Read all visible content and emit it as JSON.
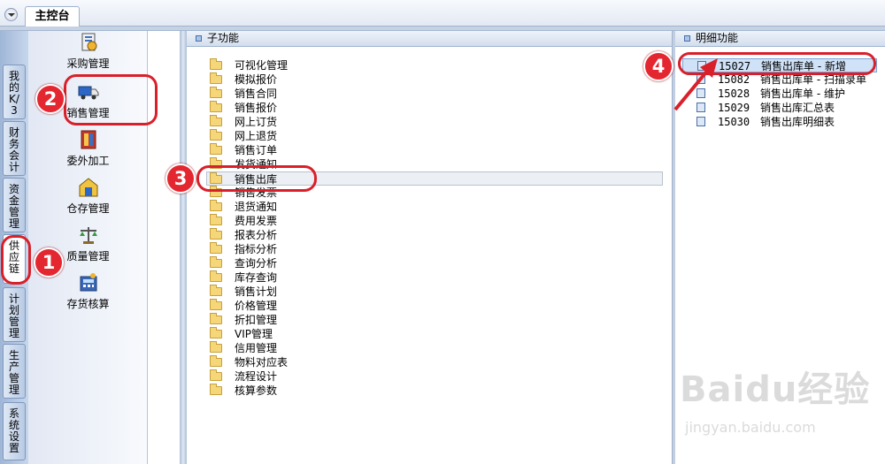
{
  "top_tab": {
    "label": "主控台"
  },
  "vertical_tabs": [
    {
      "label": "我的K/3",
      "active": false
    },
    {
      "label": "财务会计",
      "active": false
    },
    {
      "label": "资金管理",
      "active": false
    },
    {
      "label": "供应链",
      "active": true
    },
    {
      "label": "计划管理",
      "active": false
    },
    {
      "label": "生产管理",
      "active": false
    },
    {
      "label": "系统设置",
      "active": false
    }
  ],
  "modules": [
    {
      "label": "采购管理",
      "icon": "purchase-icon"
    },
    {
      "label": "销售管理",
      "icon": "sales-truck-icon",
      "selected": true
    },
    {
      "label": "委外加工",
      "icon": "outsource-icon"
    },
    {
      "label": "仓存管理",
      "icon": "warehouse-icon"
    },
    {
      "label": "质量管理",
      "icon": "quality-scale-icon"
    },
    {
      "label": "存货核算",
      "icon": "inventory-calc-icon"
    }
  ],
  "sub_panel": {
    "title": "子功能",
    "items": [
      "可视化管理",
      "模拟报价",
      "销售合同",
      "销售报价",
      "网上订货",
      "网上退货",
      "销售订单",
      "发货通知",
      "销售出库",
      "销售发票",
      "退货通知",
      "费用发票",
      "报表分析",
      "指标分析",
      "查询分析",
      "库存查询",
      "销售计划",
      "价格管理",
      "折扣管理",
      "VIP管理",
      "信用管理",
      "物料对应表",
      "流程设计",
      "核算参数"
    ],
    "selected_index": 8
  },
  "detail_panel": {
    "title": "明细功能",
    "items": [
      {
        "code": "15027",
        "label": "销售出库单 - 新增"
      },
      {
        "code": "15082",
        "label": "销售出库单 - 扫描录单"
      },
      {
        "code": "15028",
        "label": "销售出库单 - 维护"
      },
      {
        "code": "15029",
        "label": "销售出库汇总表"
      },
      {
        "code": "15030",
        "label": "销售出库明细表"
      }
    ],
    "selected_index": 0
  },
  "annotations": [
    "1",
    "2",
    "3",
    "4"
  ],
  "watermark": {
    "brand": "Baidu经验",
    "url": "jingyan.baidu.com"
  },
  "colors": {
    "accent": "#d9202a",
    "panel_border": "#9fb3cf",
    "selection": "#cfe2f8"
  }
}
